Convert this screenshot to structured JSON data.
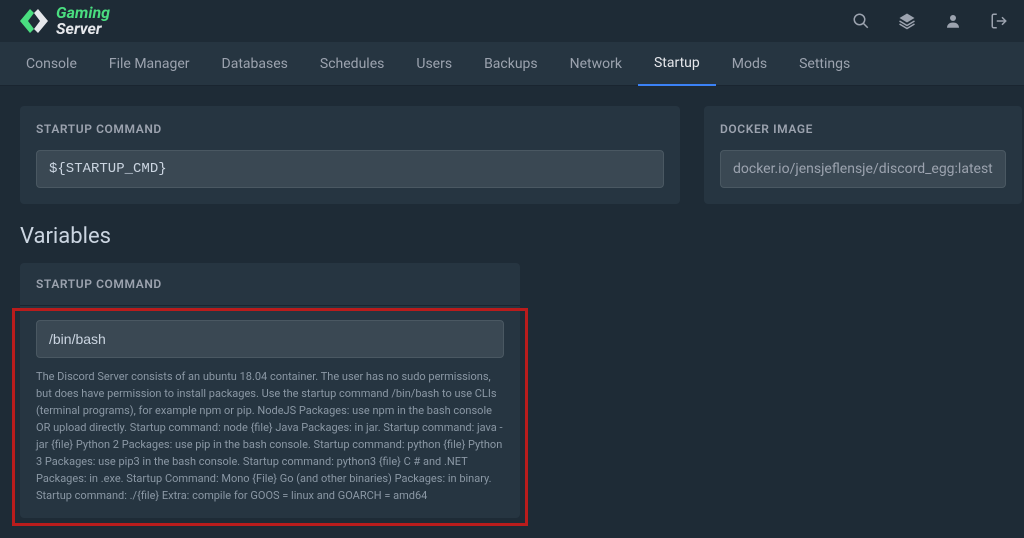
{
  "logo": {
    "line1": "Gaming",
    "line2": "Server"
  },
  "nav": {
    "items": [
      "Console",
      "File Manager",
      "Databases",
      "Schedules",
      "Users",
      "Backups",
      "Network",
      "Startup",
      "Mods",
      "Settings"
    ],
    "activeIndex": 7
  },
  "panels": {
    "startupCommand": {
      "title": "STARTUP COMMAND",
      "value": "${STARTUP_CMD}"
    },
    "dockerImage": {
      "title": "DOCKER IMAGE",
      "value": "docker.io/jensjeflensje/discord_egg:latest"
    }
  },
  "variablesSection": {
    "title": "Variables"
  },
  "variable": {
    "title": "STARTUP COMMAND",
    "value": "/bin/bash",
    "description": "The Discord Server consists of an ubuntu 18.04 container. The user has no sudo permissions, but does have permission to install packages. Use the startup command /bin/bash to use CLIs (terminal programs), for example npm or pip. NodeJS Packages: use npm in the bash console OR upload directly. Startup command: node {file} Java Packages: in jar. Startup command: java -jar {file} Python 2 Packages: use pip in the bash console. Startup command: python {file} Python 3 Packages: use pip3 in the bash console. Startup command: python3 {file} C # and .NET Packages: in .exe. Startup Command: Mono {File} Go (and other binaries) Packages: in binary. Startup command: ./{file} Extra: compile for GOOS = linux and GOARCH = amd64"
  }
}
